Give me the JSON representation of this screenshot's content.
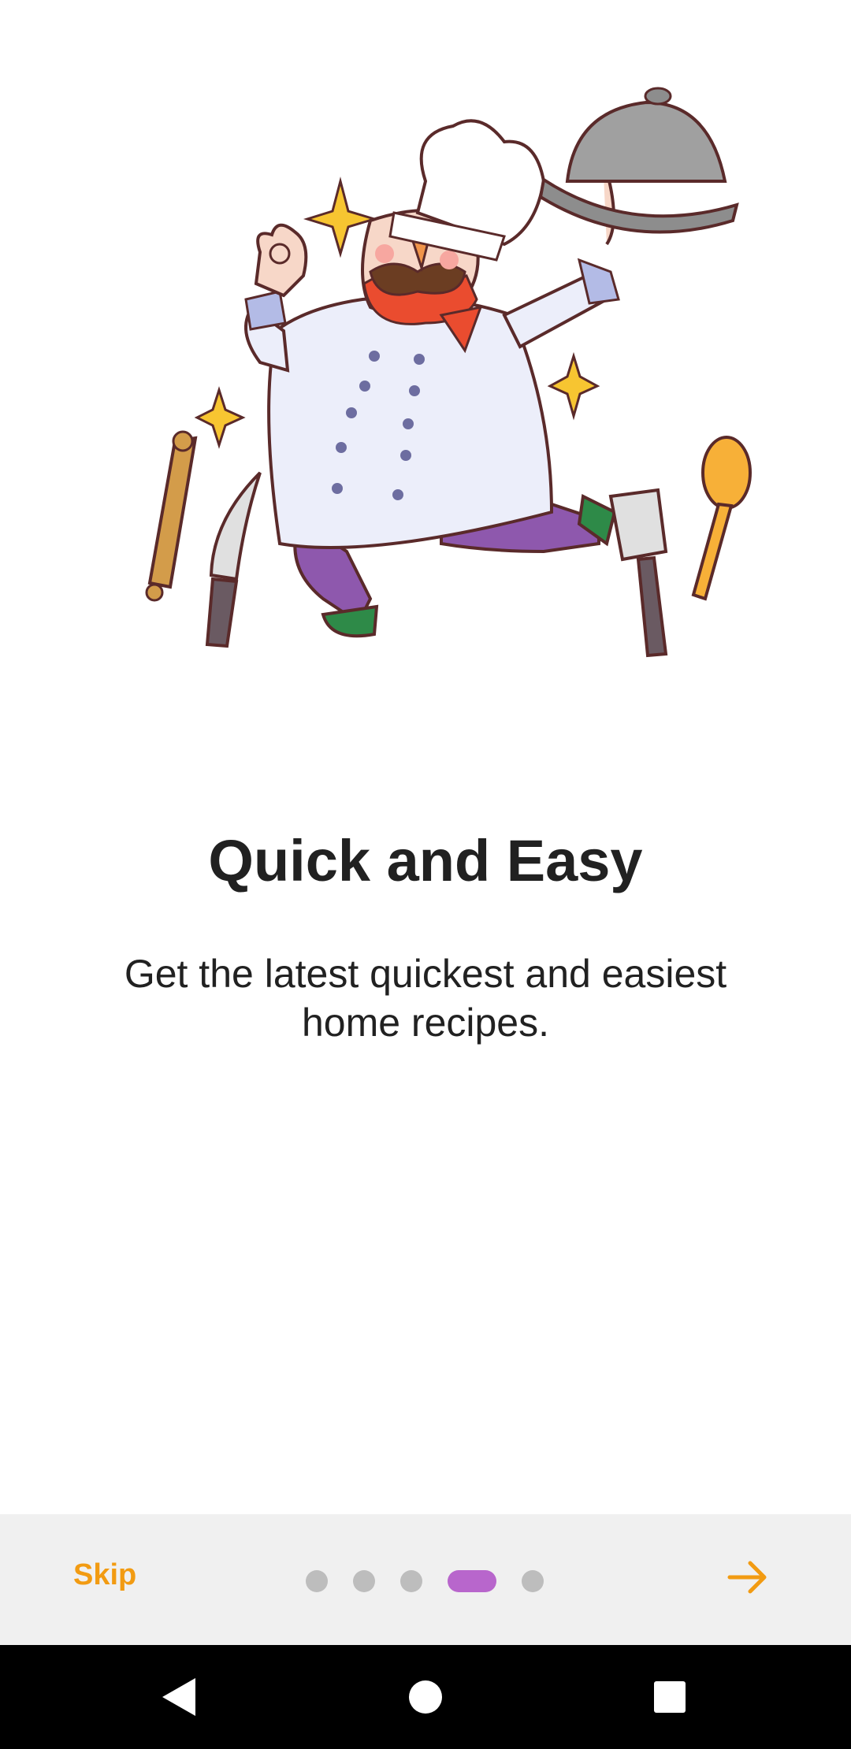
{
  "onboarding": {
    "title": "Quick and Easy",
    "subtitle": "Get the latest quickest and easiest home recipes.",
    "illustration": "chef-illustration",
    "page_index": 4,
    "page_count": 5
  },
  "bottom_bar": {
    "skip_label": "Skip",
    "next_icon": "arrow-right-icon"
  },
  "system_nav": {
    "back_icon": "back-triangle-icon",
    "home_icon": "home-circle-icon",
    "recents_icon": "recents-square-icon"
  },
  "colors": {
    "accent": "#f29b12",
    "active_dot": "#b866cc",
    "inactive_dot": "#bdbdbd",
    "bar_bg": "#f0f0f0"
  }
}
